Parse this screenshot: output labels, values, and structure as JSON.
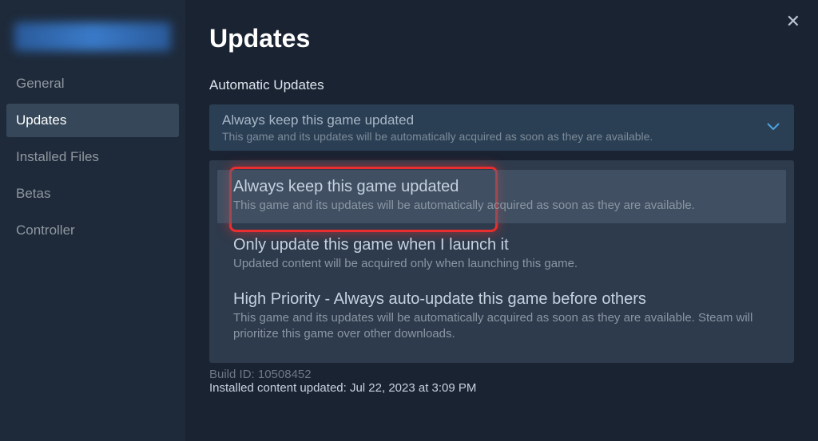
{
  "sidebar": {
    "items": [
      {
        "label": "General"
      },
      {
        "label": "Updates"
      },
      {
        "label": "Installed Files"
      },
      {
        "label": "Betas"
      },
      {
        "label": "Controller"
      }
    ]
  },
  "main": {
    "title": "Updates",
    "section_title": "Automatic Updates",
    "selected": {
      "title": "Always keep this game updated",
      "desc": "This game and its updates will be automatically acquired as soon as they are available."
    },
    "options": [
      {
        "title": "Always keep this game updated",
        "desc": "This game and its updates will be automatically acquired as soon as they are available."
      },
      {
        "title": "Only update this game when I launch it",
        "desc": "Updated content will be acquired only when launching this game."
      },
      {
        "title": "High Priority - Always auto-update this game before others",
        "desc": "This game and its updates will be automatically acquired as soon as they are available. Steam will prioritize this game over other downloads."
      }
    ],
    "build_id": "Build ID: 10508452",
    "installed_updated": "Installed content updated: Jul 22, 2023 at 3:09 PM"
  }
}
